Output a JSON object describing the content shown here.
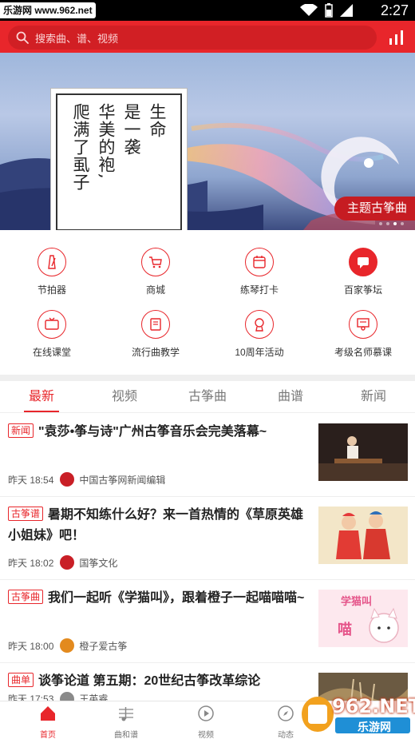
{
  "statusbar": {
    "watermark": "乐游网 www.962.net",
    "time": "2:27"
  },
  "search": {
    "placeholder": "搜索曲、谱、视频"
  },
  "banner": {
    "poem_lines": [
      "生命",
      "是一袭",
      "华美的袍,",
      "爬满了虱子"
    ],
    "tag": "主题古筝曲"
  },
  "grid": [
    {
      "label": "节拍器",
      "icon": "metronome-icon"
    },
    {
      "label": "商城",
      "icon": "cart-icon"
    },
    {
      "label": "练琴打卡",
      "icon": "calendar-icon"
    },
    {
      "label": "百家筝坛",
      "icon": "forum-icon"
    },
    {
      "label": "在线课堂",
      "icon": "tv-icon"
    },
    {
      "label": "流行曲教学",
      "icon": "book-icon"
    },
    {
      "label": "10周年活动",
      "icon": "trophy-icon"
    },
    {
      "label": "考级名师慕课",
      "icon": "teacher-icon"
    }
  ],
  "tabs": [
    "最新",
    "视频",
    "古筝曲",
    "曲谱",
    "新闻"
  ],
  "active_tab": "最新",
  "articles": [
    {
      "badge": "新闻",
      "title": "\"袁莎•筝与诗\"广州古筝音乐会完美落幕~",
      "time": "昨天 18:54",
      "source": "中国古筝网新闻编辑"
    },
    {
      "badge": "古筝谱",
      "title": "暑期不知练什么好？来一首热情的《草原英雄小姐妹》吧！",
      "time": "昨天 18:02",
      "source": "国筝文化"
    },
    {
      "badge": "古筝曲",
      "title": "我们一起听《学猫叫》，跟着橙子一起喵喵喵~",
      "time": "昨天 18:00",
      "source": "橙子爱古筝"
    },
    {
      "badge": "曲单",
      "title": "谈筝论道 第五期：20世纪古筝改革综论",
      "time": "昨天 17:53",
      "source": "王英睿"
    }
  ],
  "thumb3_text": "学猫叫",
  "thumb3_text2": "喵",
  "bottomnav": [
    {
      "label": "首页",
      "icon": "home-icon"
    },
    {
      "label": "曲和谱",
      "icon": "music-score-icon"
    },
    {
      "label": "视频",
      "icon": "play-icon"
    },
    {
      "label": "动态",
      "icon": "compass-icon"
    }
  ],
  "watermark": {
    "brand": "962.NET",
    "sub": "乐游网"
  },
  "colors": {
    "accent": "#e8262b",
    "accent_dark": "#d11f24",
    "banner_tag": "#c61c22"
  }
}
